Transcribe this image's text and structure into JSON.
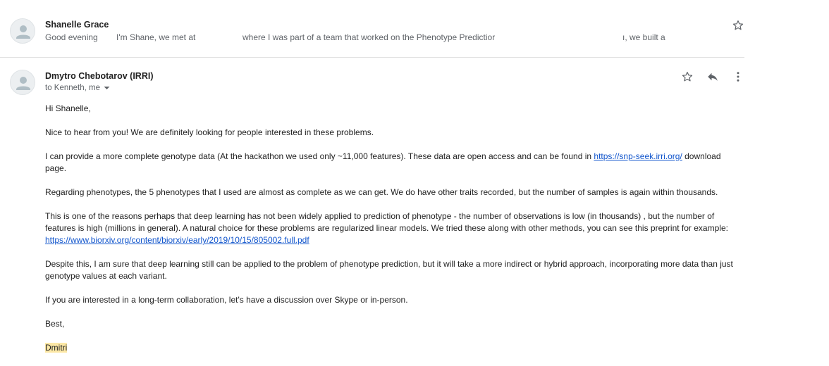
{
  "collapsed_message": {
    "sender": "Shanelle Grace",
    "snippet_part1": "Good evening",
    "snippet_part2": "I'm Shane, we met at",
    "snippet_part3": "where I was part of a team that worked on the Phenotype Predictior",
    "snippet_part4": "ı, we built a"
  },
  "message": {
    "sender": "Dmytro Chebotarov (IRRI)",
    "recipients": "to Kenneth, me",
    "greeting": "Hi Shanelle,",
    "p1": "Nice to hear from you!  We are definitely looking for people interested in these problems.",
    "p2_before": "I can provide a more complete genotype data (At the hackathon we used only ~11,000 features). These data are open access and can be found in ",
    "p2_link": "https://snp-seek.irri.org/",
    "p2_after": " download page.",
    "p3": "Regarding phenotypes, the 5 phenotypes that I used are almost as complete as we can get.  We do have other traits recorded, but the number of samples is again within thousands.",
    "p4_before": "This is one of the reasons perhaps that deep learning has not been widely applied to prediction of phenotype - the number of observations is low (in thousands) , but the number of features is high (millions in general).  A natural choice for these problems are regularized linear models. We tried these along with other methods, you can see this preprint for example: ",
    "p4_link": "https://www.biorxiv.org/content/biorxiv/early/2019/10/15/805002.full.pdf",
    "p5": "Despite this, I am sure that deep learning still can be applied to the problem of phenotype prediction, but it will take a more indirect or hybrid approach, incorporating more data than just genotype values at each variant.",
    "p6": "If you are interested in a long-term collaboration, let's have a discussion over Skype or in-person.",
    "closing": "Best,",
    "signature": "Dmitri"
  },
  "icons": {
    "star": "star-icon",
    "reply": "reply-icon",
    "more": "more-vert-icon",
    "avatar": "person-icon",
    "caret": "caret-down-icon"
  }
}
